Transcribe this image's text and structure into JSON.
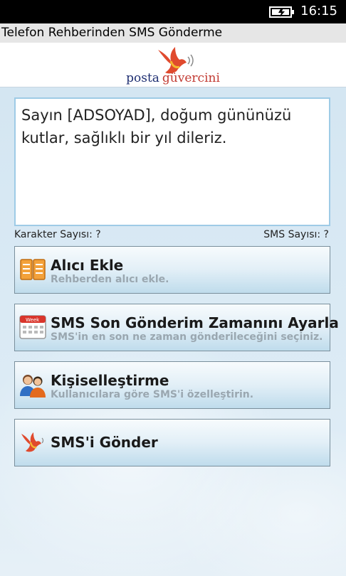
{
  "status_bar": {
    "time": "16:15",
    "battery_icon": "battery-charging-icon"
  },
  "title_bar": {
    "title": "Telefon Rehberinden SMS Gönderme"
  },
  "logo": {
    "word1": "posta",
    "word2": "güvercini"
  },
  "message": {
    "text": "Sayın [ADSOYAD], doğum gününüzü kutlar, sağlıklı bir yıl dileriz."
  },
  "counters": {
    "characters": "Karakter Sayısı: ?",
    "sms": "SMS Sayısı: ?"
  },
  "actions": [
    {
      "title": "Alıcı Ekle",
      "subtitle": "Rehberden alıcı ekle.",
      "icon": "address-book-icon"
    },
    {
      "title": "SMS Son Gönderim Zamanını Ayarla",
      "subtitle": "SMS'in en son ne zaman gönderileceğini seçiniz.",
      "icon": "calendar-icon",
      "icon_label": "Week"
    },
    {
      "title": "Kişiselleştirme",
      "subtitle": "Kullanıcılara göre SMS'i özelleştirin.",
      "icon": "users-icon"
    },
    {
      "title": "SMS'i Gönder",
      "subtitle": "",
      "icon": "dove-icon"
    }
  ],
  "colors": {
    "brand_blue": "#1f2f72",
    "brand_red": "#c23a32",
    "accent_border": "#9ecbe6"
  }
}
